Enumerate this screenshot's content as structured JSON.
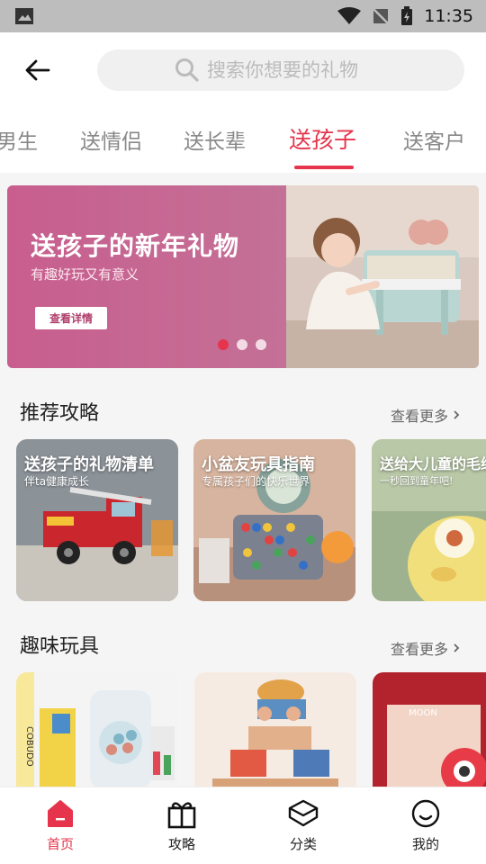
{
  "status_bar": {
    "time": "11:35",
    "icons": [
      "image-icon",
      "wifi-icon",
      "no-signal-icon",
      "battery-charging-icon"
    ]
  },
  "header": {
    "back_icon": "arrow-left-icon",
    "search_placeholder": "搜索你想要的礼物",
    "search_icon": "search-icon"
  },
  "tabs": [
    {
      "label": "男生"
    },
    {
      "label": "送情侣"
    },
    {
      "label": "送长辈"
    },
    {
      "label": "送孩子",
      "active": true
    },
    {
      "label": "送客户"
    }
  ],
  "banner": {
    "title": "送孩子的新年礼物",
    "subtitle": "有趣好玩又有意义",
    "button_label": "查看详情",
    "dots_count": 3,
    "active_dot": 0
  },
  "recommend": {
    "title": "推荐攻略",
    "more_label": "查看更多",
    "cards": [
      {
        "title": "送孩子的礼物清单",
        "subtitle": "伴ta健康成长"
      },
      {
        "title": "小盆友玩具指南",
        "subtitle": "专属孩子们的快乐世界"
      },
      {
        "title": "送给大儿童的毛绒",
        "subtitle": "一秒回到童年吧!"
      }
    ]
  },
  "toys": {
    "title": "趣味玩具",
    "more_label": "查看更多",
    "cards": [
      {
        "label": "COBUDO"
      },
      {
        "label": ""
      },
      {
        "label": "MOON"
      }
    ]
  },
  "bottom_nav": [
    {
      "label": "首页",
      "icon": "home-icon",
      "active": true
    },
    {
      "label": "攻略",
      "icon": "gift-icon"
    },
    {
      "label": "分类",
      "icon": "layers-icon"
    },
    {
      "label": "我的",
      "icon": "smile-icon"
    }
  ],
  "colors": {
    "accent": "#e5344b",
    "banner": "#c85e8e"
  }
}
